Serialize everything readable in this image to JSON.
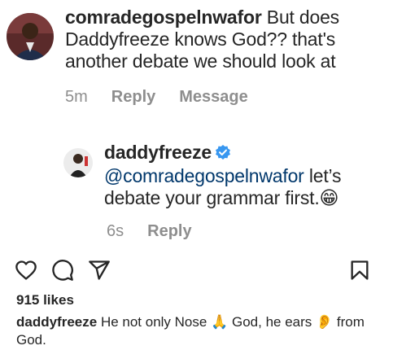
{
  "comments": [
    {
      "username": "comradegospelnwafor",
      "text": "But does Daddyfreeze knows God?? that's another debate we should look at",
      "time": "5m",
      "reply_label": "Reply",
      "message_label": "Message"
    },
    {
      "username": "daddyfreeze",
      "verified": true,
      "mention": "@comradegospelnwafor",
      "text": "let’s debate your grammar first.",
      "emoji": "😁",
      "time": "6s",
      "reply_label": "Reply"
    }
  ],
  "post": {
    "likes": "915 likes",
    "caption_username": "daddyfreeze",
    "caption_part1": "He not only Nose",
    "emoji_pray": "🙏",
    "caption_part2": "God, he ears",
    "emoji_ear": "👂",
    "caption_part3": "from God."
  },
  "colors": {
    "text": "#262626",
    "muted": "#8e8e8e",
    "mention": "#00376b",
    "verified": "#3897f0"
  },
  "icons": [
    "heart-icon",
    "comment-icon",
    "share-icon",
    "bookmark-icon",
    "verified-badge-icon"
  ]
}
